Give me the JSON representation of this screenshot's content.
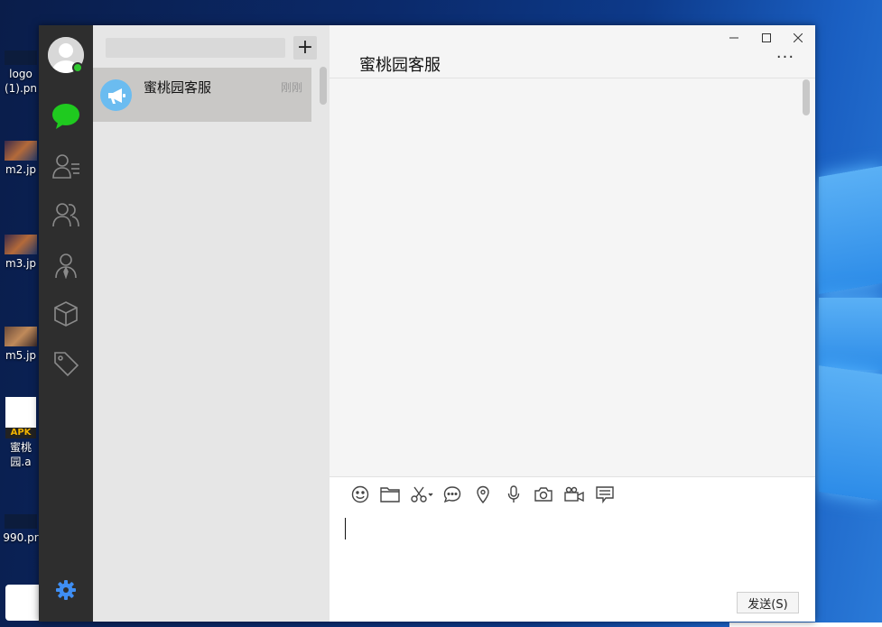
{
  "desktop": {
    "icons": [
      {
        "label": "logo\n(1).pn"
      },
      {
        "label": "m2.jp"
      },
      {
        "label": "m3.jp"
      },
      {
        "label": "m5.jp"
      },
      {
        "label": "蜜桃园.a",
        "badge": "APK"
      },
      {
        "label": "990.pr"
      }
    ]
  },
  "nav": {
    "items": [
      {
        "name": "chats",
        "icon": "chat-bubble-icon",
        "active": true
      },
      {
        "name": "contacts",
        "icon": "contact-card-icon"
      },
      {
        "name": "groups",
        "icon": "group-icon"
      },
      {
        "name": "customer-service",
        "icon": "person-tie-icon"
      },
      {
        "name": "apps",
        "icon": "cube-icon"
      },
      {
        "name": "tags",
        "icon": "tag-icon"
      }
    ],
    "settings_icon": "gear-icon",
    "online_color": "#2fc82f",
    "active_color": "#1fca1f",
    "settings_color": "#3f8ef3"
  },
  "conversation_list": {
    "search_placeholder": "",
    "add_label": "+",
    "items": [
      {
        "name": "蜜桃园客服",
        "time": "刚刚",
        "avatar_icon": "megaphone-icon",
        "avatar_color": "#6bbcf0"
      }
    ]
  },
  "chat": {
    "title": "蜜桃园客服",
    "more_label": "···",
    "window_controls": [
      "minimize-icon",
      "maximize-icon",
      "close-icon"
    ],
    "toolbar": [
      "emoji-icon",
      "folder-icon",
      "scissors-icon",
      "speech-bubble-icon",
      "location-pin-icon",
      "microphone-icon",
      "camera-icon",
      "video-camera-icon",
      "message-list-icon"
    ],
    "input_value": "",
    "send_label": "发送(S)"
  }
}
